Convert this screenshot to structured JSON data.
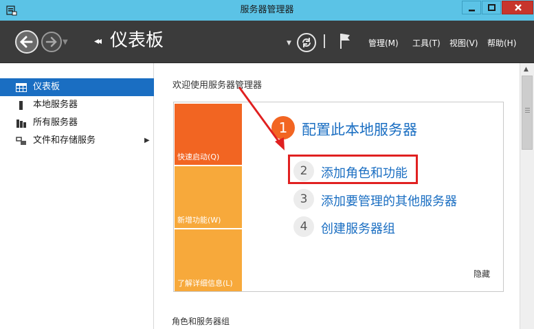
{
  "window": {
    "title": "服务器管理器"
  },
  "header": {
    "page_title": "仪表板",
    "menus": [
      "管理(M)",
      "工具(T)",
      "视图(V)",
      "帮助(H)"
    ]
  },
  "sidebar": {
    "items": [
      {
        "label": "仪表板",
        "icon": "dashboard-icon",
        "active": true
      },
      {
        "label": "本地服务器",
        "icon": "server-icon",
        "active": false
      },
      {
        "label": "所有服务器",
        "icon": "servers-icon",
        "active": false
      },
      {
        "label": "文件和存储服务",
        "icon": "storage-icon",
        "active": false,
        "expandable": true
      }
    ]
  },
  "main": {
    "welcome": "欢迎使用服务器管理器",
    "tiles": [
      "快速启动(Q)",
      "新增功能(W)",
      "了解详细信息(L)"
    ],
    "steps": [
      {
        "num": "1",
        "label": "配置此本地服务器"
      },
      {
        "num": "2",
        "label": "添加角色和功能"
      },
      {
        "num": "3",
        "label": "添加要管理的其他服务器"
      },
      {
        "num": "4",
        "label": "创建服务器组"
      }
    ],
    "hide": "隐藏",
    "roles_heading": "角色和服务器组"
  },
  "colors": {
    "titlebar": "#5bc3e6",
    "header": "#3b3b3b",
    "accent": "#1a6ec2",
    "tile_quick": "#f26522",
    "tile_other": "#f7a93b",
    "highlight": "#e02020"
  }
}
